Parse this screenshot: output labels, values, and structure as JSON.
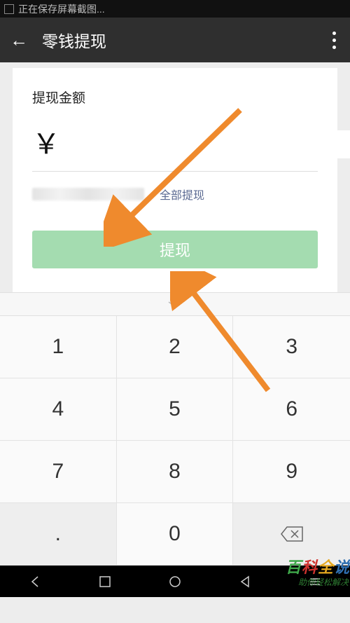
{
  "status_bar": {
    "text": "正在保存屏幕截图..."
  },
  "nav": {
    "title": "零钱提现"
  },
  "card": {
    "label": "提现金额",
    "currency": "￥",
    "amount_value": "",
    "withdraw_all": "全部提现",
    "comma": "，",
    "button": "提现"
  },
  "keypad": {
    "rows": [
      [
        "1",
        "2",
        "3"
      ],
      [
        "4",
        "5",
        "6"
      ],
      [
        "7",
        "8",
        "9"
      ],
      [
        ".",
        "0",
        "del"
      ]
    ],
    "k1": "1",
    "k2": "2",
    "k3": "3",
    "k4": "4",
    "k5": "5",
    "k6": "6",
    "k7": "7",
    "k8": "8",
    "k9": "9",
    "k0": "0",
    "kdot": "."
  },
  "watermark": {
    "c1": "百",
    "c2": "科",
    "c3": "全",
    "c4": "说",
    "sub": "助你轻松解决"
  }
}
